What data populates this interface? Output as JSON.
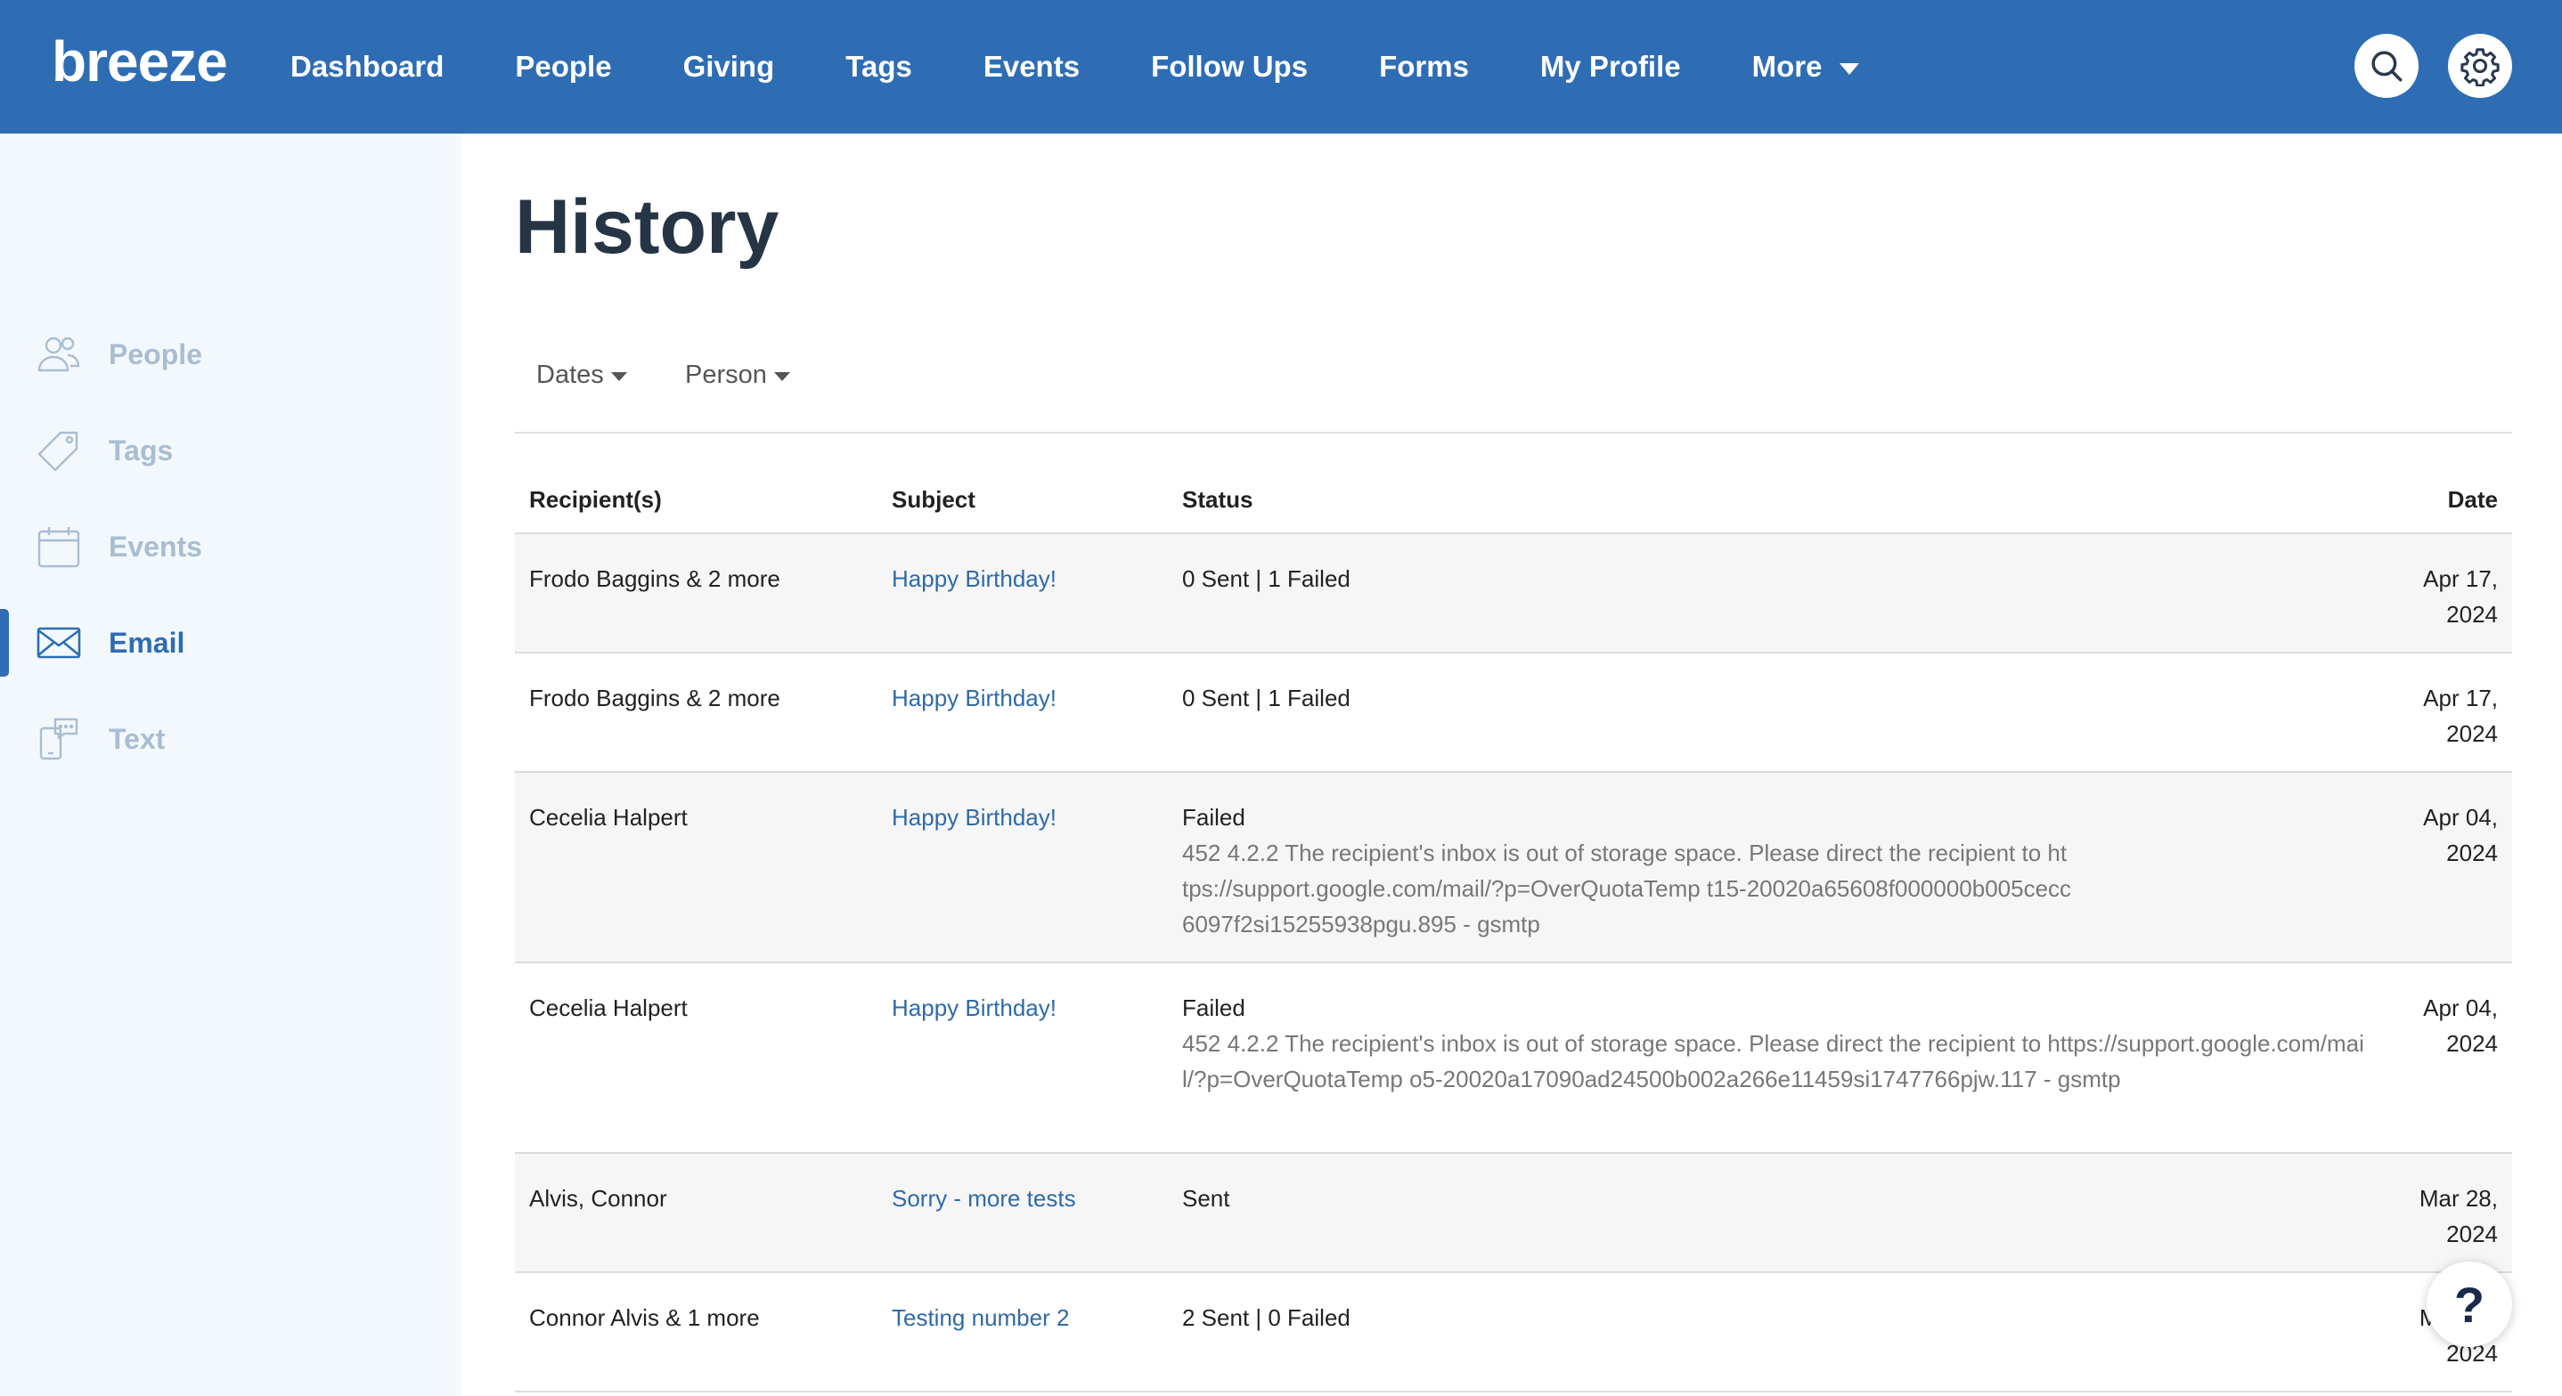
{
  "app": {
    "logo": "breeze"
  },
  "nav": {
    "items": [
      {
        "label": "Dashboard"
      },
      {
        "label": "People"
      },
      {
        "label": "Giving"
      },
      {
        "label": "Tags"
      },
      {
        "label": "Events"
      },
      {
        "label": "Follow Ups"
      },
      {
        "label": "Forms"
      },
      {
        "label": "My Profile"
      },
      {
        "label": "More"
      }
    ],
    "search_icon": "search-icon",
    "settings_icon": "gear-icon"
  },
  "sidebar": {
    "items": [
      {
        "label": "People",
        "icon": "people-icon"
      },
      {
        "label": "Tags",
        "icon": "tag-icon"
      },
      {
        "label": "Events",
        "icon": "calendar-icon"
      },
      {
        "label": "Email",
        "icon": "envelope-icon",
        "active": true
      },
      {
        "label": "Text",
        "icon": "phone-message-icon"
      }
    ]
  },
  "main": {
    "title": "History",
    "filters": {
      "dates": "Dates",
      "person": "Person"
    },
    "table": {
      "headers": {
        "recipients": "Recipient(s)",
        "subject": "Subject",
        "status": "Status",
        "date": "Date"
      },
      "rows": [
        {
          "recipients": "Frodo Baggins & 2 more",
          "subject": "Happy Birthday!",
          "status": "0 Sent | 1 Failed",
          "detail": "",
          "date_line1": "Apr 17,",
          "date_line2": "2024"
        },
        {
          "recipients": "Frodo Baggins & 2 more",
          "subject": "Happy Birthday!",
          "status": "0 Sent | 1 Failed",
          "detail": "",
          "date_line1": "Apr 17,",
          "date_line2": "2024"
        },
        {
          "recipients": "Cecelia Halpert",
          "subject": "Happy Birthday!",
          "status": "Failed",
          "detail": "452 4.2.2 The recipient's inbox is out of storage space. Please direct the recipient to https://support.google.com/mail/?p=OverQuotaTemp t15-20020a65608f000000b005cecc6097f2si15255938pgu.895 - gsmtp",
          "date_line1": "Apr 04,",
          "date_line2": "2024"
        },
        {
          "recipients": "Cecelia Halpert",
          "subject": "Happy Birthday!",
          "status": "Failed",
          "detail": "452 4.2.2 The recipient's inbox is out of storage space. Please direct the recipient to https://support.google.com/mail/?p=OverQuotaTemp o5-20020a17090ad24500b002a266e11459si1747766pjw.117 - gsmtp",
          "date_line1": "Apr 04,",
          "date_line2": "2024"
        },
        {
          "recipients": "Alvis, Connor",
          "subject": "Sorry - more tests",
          "status": "Sent",
          "detail": "",
          "date_line1": "Mar 28,",
          "date_line2": "2024"
        },
        {
          "recipients": "Connor Alvis & 1 more",
          "subject": "Testing number 2",
          "status": "2 Sent | 0 Failed",
          "detail": "",
          "date_line1": "Mar 28,",
          "date_line2": "2024"
        }
      ]
    }
  },
  "help": {
    "label": "?"
  },
  "colors": {
    "brand": "#2e6db4",
    "sidebar_bg": "#f3f8fc",
    "link": "#2e6aa8"
  }
}
